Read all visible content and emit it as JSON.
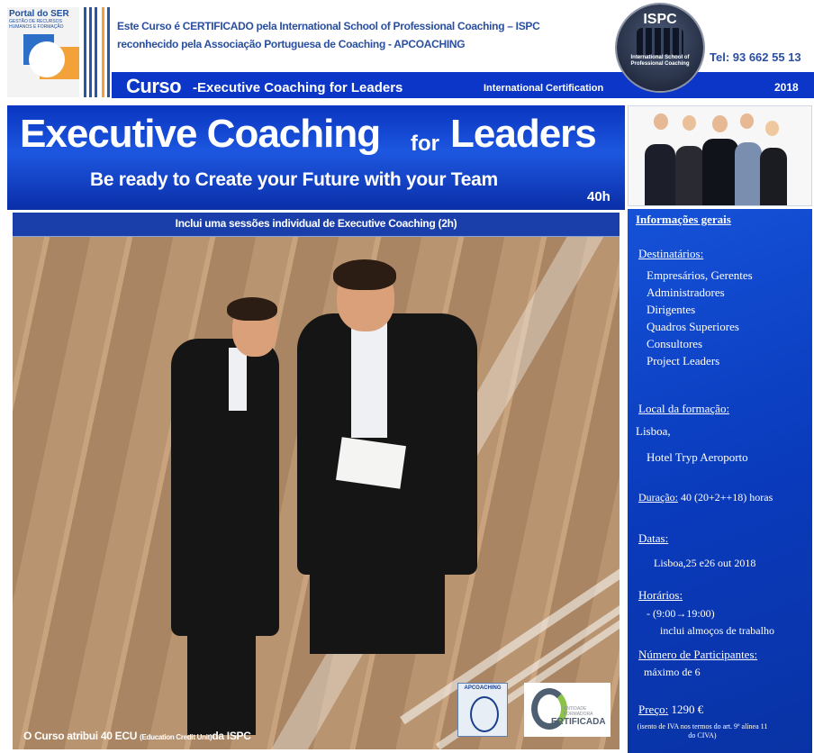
{
  "header": {
    "logo_title": "Portal do SER",
    "logo_tagline": "GESTÃO DE RECURSOS HUMANOS E FORMAÇÃO",
    "cert_line1": "Este Curso é CERTIFICADO pela International School of Professional Coaching – ISPC",
    "cert_line2": "reconhecido pela Associação Portuguesa de Coaching - APCOACHING",
    "ispc_name": "ISPC",
    "ispc_subtitle": "International School of Professional Coaching",
    "phone": "Tel: 93 662 55 13",
    "curso_word": "Curso",
    "curso_title": "-Executive Coaching for Leaders",
    "intl_cert": "International Certification",
    "year": "2018"
  },
  "banner": {
    "title_main": "Executive Coaching",
    "title_for": "for",
    "title_leaders": "Leaders",
    "subtitle": "Be ready to Create your Future with your Team",
    "hours": "40h"
  },
  "photo": {
    "caption": "Inclui uma sessões individual de Executive Coaching (2h)",
    "footer_main": "O Curso atribui 40 ECU",
    "footer_small": "(Education Credit Unit)",
    "footer_end": "da ISPC"
  },
  "logos": {
    "apco": "APCOACHING",
    "cert": "ERTIFICADA",
    "cert_sub": "ENTIDADE FORMADORA"
  },
  "info": {
    "heading": "Informações gerais",
    "destinatarios_label": "Destinatários:",
    "destinatarios": [
      "Empresários, Gerentes",
      "Administradores",
      "Dirigentes",
      "Quadros  Superiores",
      "Consultores",
      "Project Leaders"
    ],
    "local_label": "Local da formação:",
    "local_city": "Lisboa,",
    "local_hotel": "Hotel Tryp Aeroporto",
    "duracao_label": "Duração:",
    "duracao_value": "40 (20+2++18) horas",
    "datas_label": "Datas:",
    "datas_value": "Lisboa,25 e26 out 2018",
    "horarios_label": "Horários:",
    "horarios_value": "-  (9:00→19:00)",
    "horarios_note": "inclui almoços de trabalho",
    "participantes_label": "Número de Participantes:",
    "participantes_value": "máximo de 6",
    "preco_label": "Preço:",
    "preco_value": "1290 €",
    "preco_note": "(isento de IVA nos termos do art. 9º alínea 11 do CIVA)"
  },
  "colors": {
    "brand_blue": "#0b36c8",
    "header_text": "#2a4fa0",
    "accent_orange": "#f3a23a"
  }
}
